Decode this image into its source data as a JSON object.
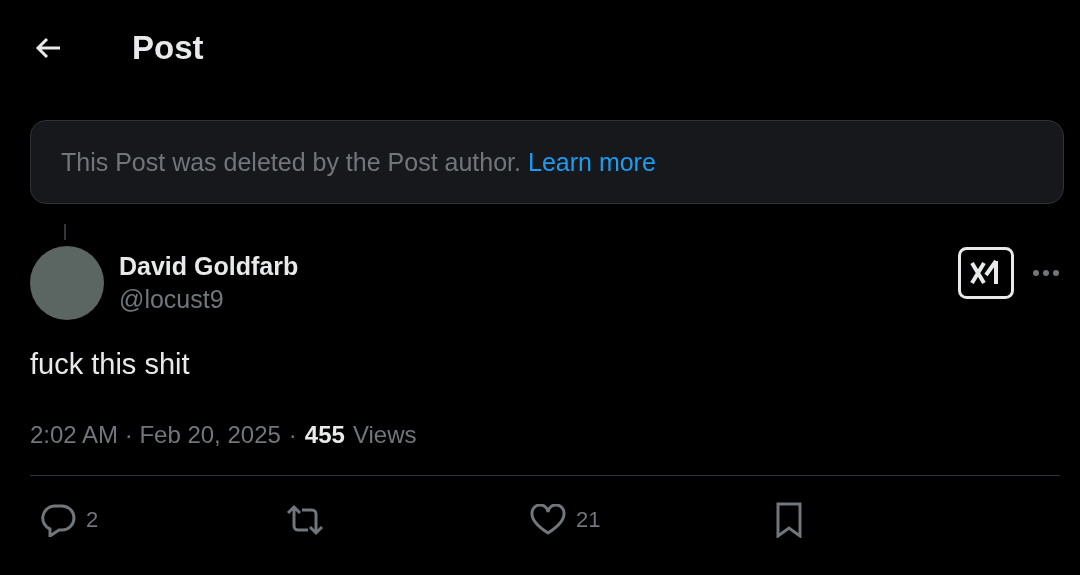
{
  "header": {
    "title": "Post"
  },
  "notice": {
    "text": "This Post was deleted by the Post author.",
    "link": "Learn more"
  },
  "post": {
    "author": {
      "name": "David Goldfarb",
      "handle": "@locust9"
    },
    "text": "fuck this shit",
    "time": "2:02 AM · Feb 20, 2025",
    "separator": "·",
    "views": "455",
    "views_label": "Views"
  },
  "actions": [
    {
      "kind": "reply",
      "count": "2"
    },
    {
      "kind": "repost"
    },
    {
      "kind": "like",
      "count": "21"
    },
    {
      "kind": "bookmark"
    }
  ]
}
